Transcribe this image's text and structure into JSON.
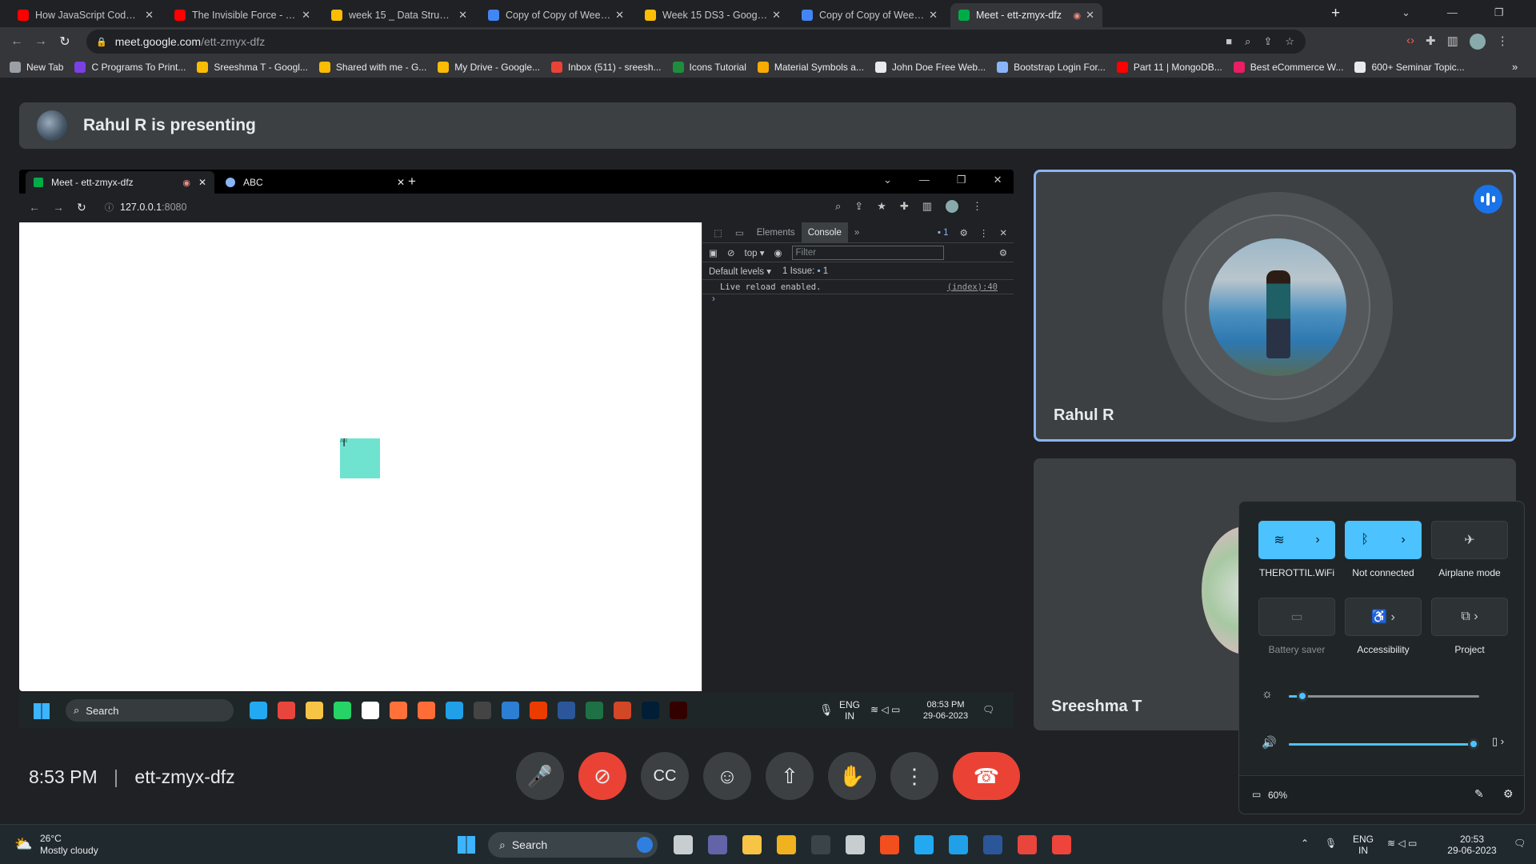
{
  "browser": {
    "tabs": [
      {
        "title": "How JavaScript Code is executed",
        "color": "#ff0000"
      },
      {
        "title": "The Invisible Force - self-image",
        "color": "#ff0000"
      },
      {
        "title": "week 15 _ Data Structure - Goog",
        "color": "#fbbc04"
      },
      {
        "title": "Copy of Copy of Week 3_ Data S",
        "color": "#4285f4"
      },
      {
        "title": "Week 15 DS3 - Google Drive",
        "color": "#fbbc04"
      },
      {
        "title": "Copy of Copy of Week 3_ Data S",
        "color": "#4285f4"
      },
      {
        "title": "Meet - ett-zmyx-dfz",
        "color": "#00ac47"
      }
    ],
    "url_host": "meet.google.com",
    "url_path": "/ett-zmyx-dfz",
    "bookmarks": [
      "New Tab",
      "C Programs To Print...",
      "Sreeshma T - Googl...",
      "Shared with me - G...",
      "My Drive - Google...",
      "Inbox (511) - sreesh...",
      "Icons Tutorial",
      "Material Symbols a...",
      "John Doe Free Web...",
      "Bootstrap Login For...",
      "Part 11 | MongoDB...",
      "Best eCommerce W...",
      "600+ Seminar Topic..."
    ]
  },
  "meet": {
    "presenting_banner": "Rahul R is presenting",
    "time": "8:53 PM",
    "meeting_code": "ett-zmyx-dfz",
    "participants": [
      {
        "name": "Rahul R",
        "speaking": true
      },
      {
        "name": "Sreeshma T",
        "speaking": false
      }
    ]
  },
  "shared_screen": {
    "tabs": [
      "Meet - ett-zmyx-dfz",
      "ABC"
    ],
    "url_host": "127.0.0.1",
    "url_port": ":8080",
    "box_text": "AB",
    "devtools": {
      "panels": [
        "Elements",
        "Console"
      ],
      "issues_badge": "1",
      "context": "top",
      "filter_placeholder": "Filter",
      "levels": "Default levels",
      "issues": "1 Issue:",
      "issues_count": "1",
      "log_message": "Live reload enabled.",
      "log_source": "(index):40"
    },
    "taskbar": {
      "search": "Search",
      "lang1": "ENG",
      "lang2": "IN",
      "time": "08:53 PM",
      "date": "29-06-2023"
    }
  },
  "quick_settings": {
    "wifi_label": "THEROTTIL.WiFi",
    "bluetooth_label": "Not connected",
    "airplane_label": "Airplane mode",
    "battery_saver_label": "Battery saver",
    "accessibility_label": "Accessibility",
    "project_label": "Project",
    "brightness": 0.07,
    "volume": 0.97,
    "battery": "60%"
  },
  "windows_taskbar": {
    "weather_temp": "26°C",
    "weather_desc": "Mostly cloudy",
    "search": "Search",
    "lang1": "ENG",
    "lang2": "IN",
    "time": "20:53",
    "date": "29-06-2023"
  }
}
